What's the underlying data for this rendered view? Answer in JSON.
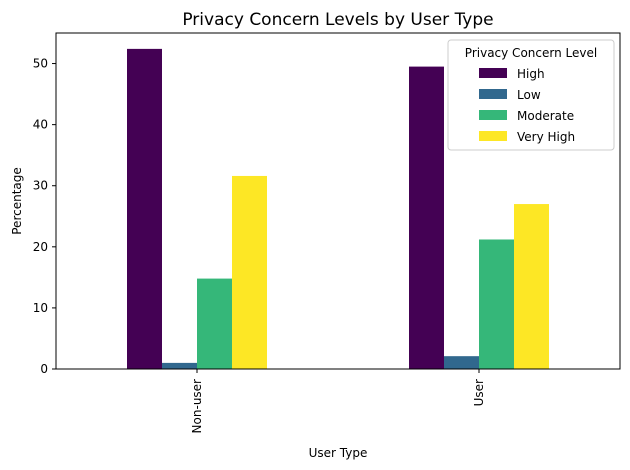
{
  "chart_data": {
    "type": "bar",
    "title": "Privacy Concern Levels by User Type",
    "xlabel": "User Type",
    "ylabel": "Percentage",
    "categories": [
      "Non-user",
      "User"
    ],
    "series": [
      {
        "name": "High",
        "color": "#440154",
        "values": [
          52.4,
          49.5
        ]
      },
      {
        "name": "Low",
        "color": "#31688e",
        "values": [
          1.0,
          2.1
        ]
      },
      {
        "name": "Moderate",
        "color": "#35b779",
        "values": [
          14.8,
          21.2
        ]
      },
      {
        "name": "Very High",
        "color": "#fde725",
        "values": [
          31.6,
          27.0
        ]
      }
    ],
    "ylim": [
      0,
      55
    ],
    "yticks": [
      0,
      10,
      20,
      30,
      40,
      50
    ],
    "legend": {
      "title": "Privacy Concern Level",
      "placement": "top-right"
    },
    "grid": false
  }
}
